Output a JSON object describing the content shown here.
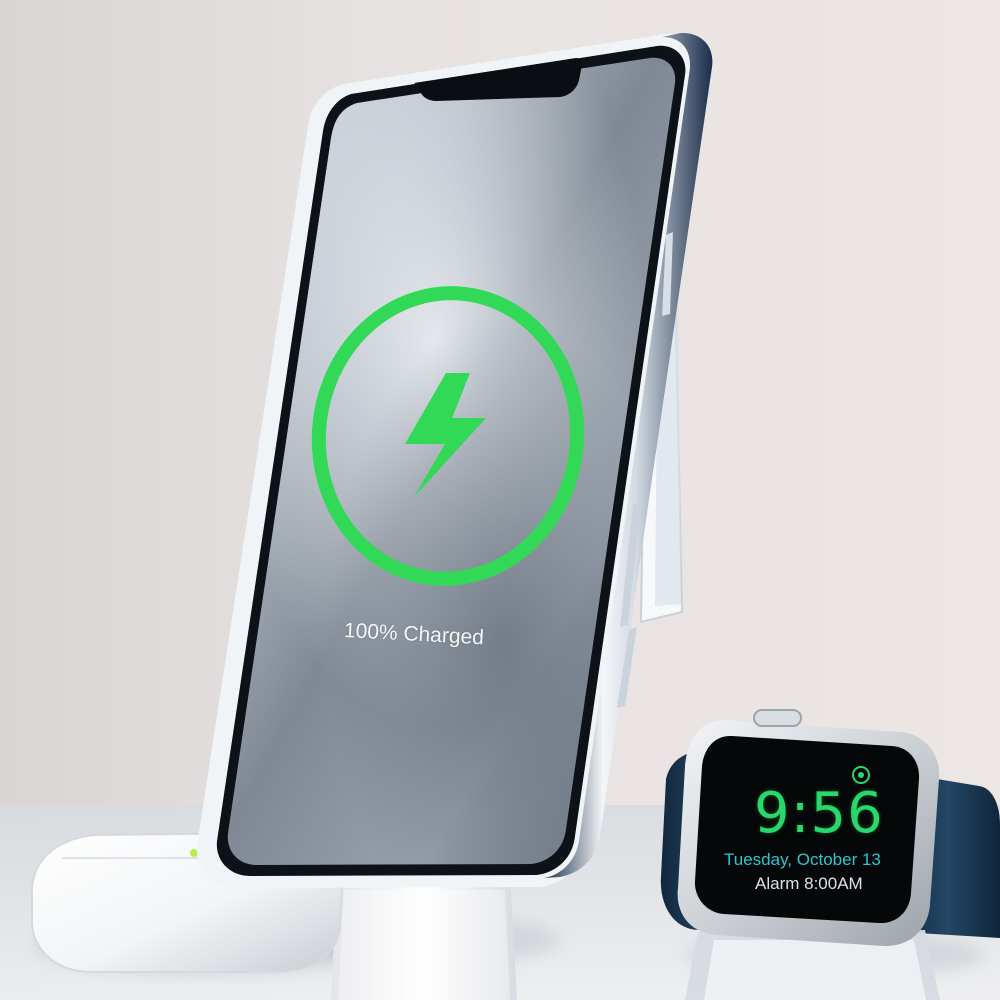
{
  "phone": {
    "charge_status": "100% Charged",
    "charge_ring_color": "#31d957",
    "bolt_icon": "lightning-bolt-icon"
  },
  "watch": {
    "time": "9:56",
    "date": "Tuesday, October 13",
    "alarm": "Alarm 8:00AM",
    "time_color": "#27d86a",
    "date_color": "#2ec7cf"
  }
}
